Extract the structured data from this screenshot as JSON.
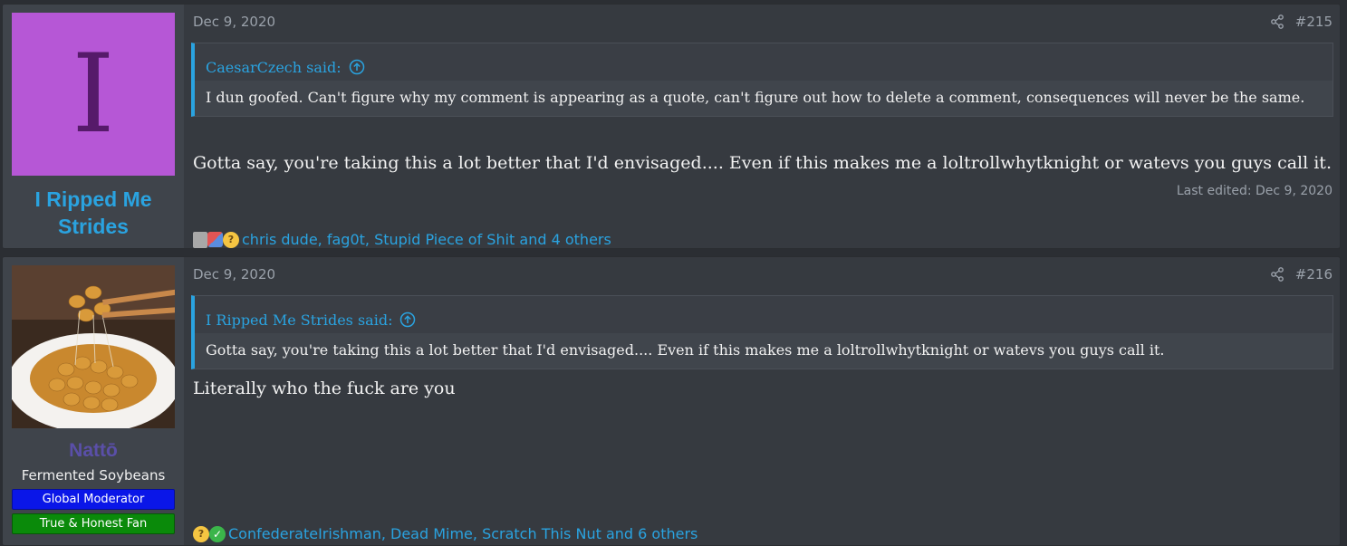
{
  "posts": [
    {
      "author": {
        "avatar_letter": "I",
        "avatar_color": "#b657d6",
        "name": "I Ripped Me\nStrides",
        "name_line1": "I Ripped Me",
        "name_line2": "Strides",
        "name_color": "#2aa3e0"
      },
      "date": "Dec 9, 2020",
      "number": "#215",
      "quote": {
        "attribution": "CaesarCzech said:",
        "text": "I dun goofed. Can't figure why my comment is appearing as a quote, can't figure out how to delete a comment, consequences will never be the same."
      },
      "message": "Gotta say, you're taking this a lot better that I'd envisaged.... Even if this makes me a loltrollwhytknight or watevs you guys call it.",
      "last_edited": "Last edited: Dec 9, 2020",
      "reactions": {
        "icons": [
          "gray-reaction-icon",
          "puzzle-reaction-icon",
          "thinking-emoji-icon"
        ],
        "text": "chris dude, fag0t, Stupid Piece of Shit and 4 others"
      }
    },
    {
      "author": {
        "avatar_description": "natto-image",
        "name": "Nattō",
        "name_color": "#5a4fa8",
        "user_title": "Fermented Soybeans",
        "banners": [
          {
            "label": "Global Moderator",
            "color": "#0a16e8"
          },
          {
            "label": "True & Honest Fan",
            "color": "#0a8a0a"
          }
        ]
      },
      "date": "Dec 9, 2020",
      "number": "#216",
      "quote": {
        "attribution": "I Ripped Me Strides said:",
        "text": "Gotta say, you're taking this a lot better that I'd envisaged.... Even if this makes me a loltrollwhytknight or watevs you guys call it."
      },
      "message": "Literally who the fuck are you",
      "reactions": {
        "icons": [
          "thinking-emoji-icon",
          "check-emoji-icon"
        ],
        "text": "ConfederateIrishman, Dead Mime, Scratch This Nut and 6 others"
      }
    }
  ]
}
